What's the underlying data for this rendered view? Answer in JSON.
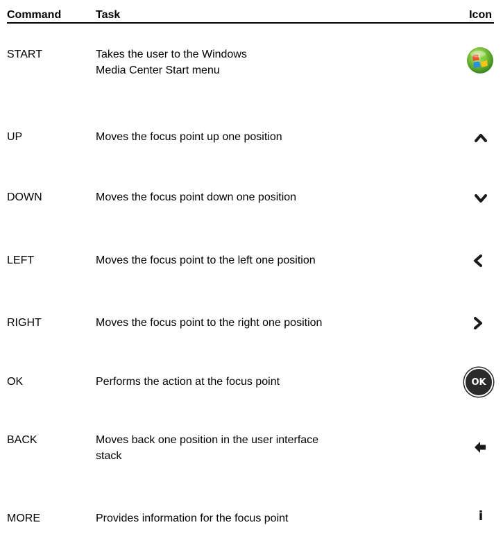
{
  "header": {
    "command": "Command",
    "task": "Task",
    "icon": "Icon"
  },
  "rows": [
    {
      "command": "START",
      "task": [
        "Takes the user to the Windows",
        "Media Center Start menu"
      ],
      "icon": "windows-start-orb-icon"
    },
    {
      "command": "UP",
      "task": [
        "Moves the focus point up one position"
      ],
      "icon": "chevron-up-icon"
    },
    {
      "command": "DOWN",
      "task": [
        "Moves the focus point down one position"
      ],
      "icon": "chevron-down-icon"
    },
    {
      "command": "LEFT",
      "task": [
        "Moves the focus point to the left one position"
      ],
      "icon": "chevron-left-icon"
    },
    {
      "command": "RIGHT",
      "task": [
        "Moves the focus point to the right one position"
      ],
      "icon": "chevron-right-icon"
    },
    {
      "command": "OK",
      "task": [
        "Performs the action at the focus point"
      ],
      "icon": "ok-button-icon",
      "icon_text": "OK"
    },
    {
      "command": "BACK",
      "task": [
        "Moves back one position in the user interface",
        "stack"
      ],
      "icon": "back-arrow-icon"
    },
    {
      "command": "MORE",
      "task": [
        "Provides information for the focus point"
      ],
      "icon": "info-icon",
      "icon_text": "i"
    }
  ],
  "colors": {
    "text": "#000000",
    "icon_dark": "#1a1a1a",
    "windows_green": "#6ab82e",
    "windows_red": "#e8512b",
    "windows_blue": "#2a8ee0",
    "windows_yellow": "#f5c518"
  }
}
